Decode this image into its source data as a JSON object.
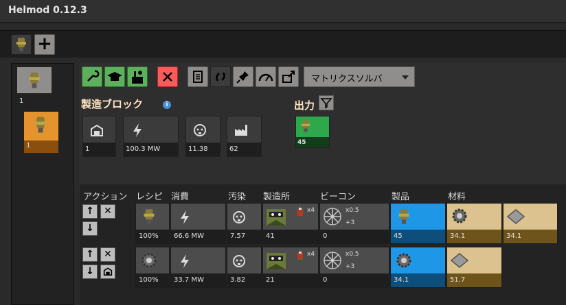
{
  "app": {
    "title": "Helmod 0.12.3"
  },
  "tabs": {
    "add_label": "+"
  },
  "left_panel": {
    "items": [
      {
        "count": "1"
      },
      {
        "count": "1"
      }
    ]
  },
  "toolbar": {
    "solver_label": "マトリクスソルバ"
  },
  "block": {
    "title": "製造ブロック",
    "info_icon": "i",
    "output_title": "出力",
    "output_item": {
      "value": "45"
    },
    "stats": [
      {
        "icon": "building-icon",
        "value": "1"
      },
      {
        "icon": "power-icon",
        "value": "100.3 MW"
      },
      {
        "icon": "pollution-icon",
        "value": "11.38"
      },
      {
        "icon": "factory-icon",
        "value": "62"
      }
    ]
  },
  "table": {
    "headers": [
      "アクション",
      "レシピ",
      "消費",
      "汚染",
      "製造所",
      "ビーコン",
      "製品",
      "材料"
    ],
    "rows": [
      {
        "recipe": "100%",
        "power": "66.6 MW",
        "pollution": "7.57",
        "factory": "41",
        "factory_modules": "x4",
        "beacon": "0",
        "beacon_mult": "x0.5",
        "beacon_plus": "+3",
        "products": [
          "45"
        ],
        "ingredients": [
          "34.1",
          "34.1"
        ]
      },
      {
        "recipe": "100%",
        "power": "33.7 MW",
        "pollution": "3.82",
        "factory": "21",
        "factory_modules": "x4",
        "beacon": "0",
        "beacon_mult": "x0.5",
        "beacon_plus": "+3",
        "products": [
          "34.1"
        ],
        "ingredients": [
          "51.7"
        ]
      }
    ]
  },
  "colors": {
    "product": "#1f97e7",
    "ingredient": "#dbc28f",
    "output": "#2ea84a",
    "selected": "#e5932d"
  }
}
